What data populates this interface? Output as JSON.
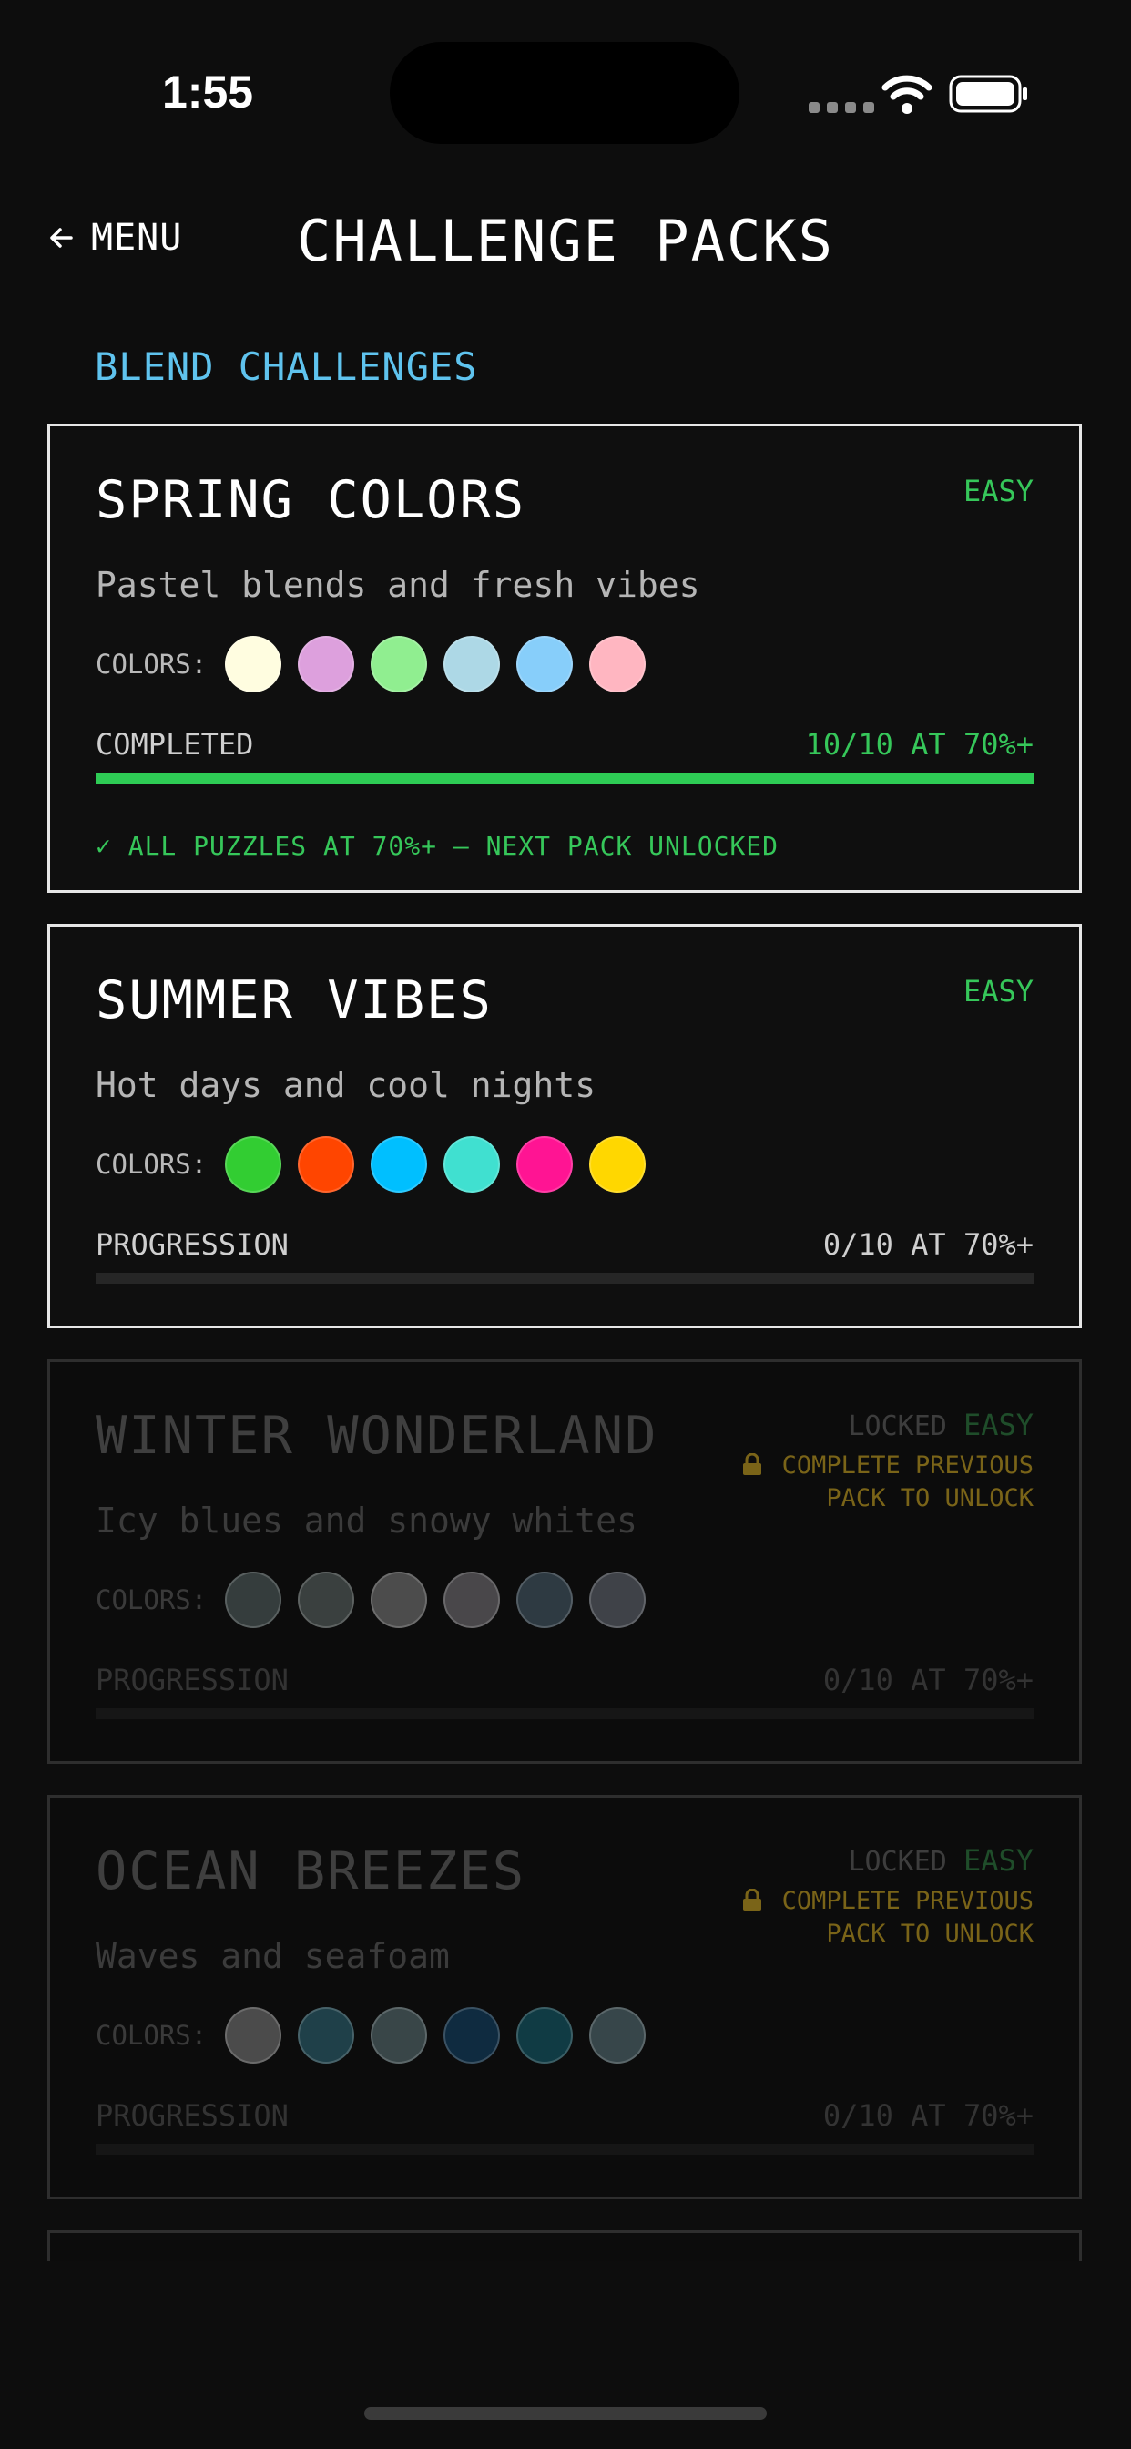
{
  "status_bar": {
    "time": "1:55"
  },
  "header": {
    "back_label": "MENU",
    "title": "CHALLENGE PACKS"
  },
  "section": {
    "title": "BLEND CHALLENGES"
  },
  "packs": [
    {
      "title": "SPRING COLORS",
      "difficulty": "EASY",
      "description": "Pastel blends and fresh vibes",
      "colors_label": "COLORS:",
      "colors": [
        "#fffde0",
        "#dda0dd",
        "#90ee90",
        "#add8e6",
        "#87cefa",
        "#ffb6c1"
      ],
      "progress_label": "COMPLETED",
      "progress_value": "10/10 AT 70%+",
      "progress_fraction": 1.0,
      "completion_note": "✓ ALL PUZZLES AT 70%+ — NEXT PACK UNLOCKED"
    },
    {
      "title": "SUMMER VIBES",
      "difficulty": "EASY",
      "description": "Hot days and cool nights",
      "colors_label": "COLORS:",
      "colors": [
        "#32cd32",
        "#ff4500",
        "#00bfff",
        "#40e0d0",
        "#ff1493",
        "#ffd700"
      ],
      "progress_label": "PROGRESSION",
      "progress_value": "0/10 AT 70%+",
      "progress_fraction": 0.0
    },
    {
      "title": "WINTER WONDERLAND",
      "locked_label": "LOCKED",
      "difficulty": "EASY",
      "unlock_line1": "COMPLETE PREVIOUS",
      "unlock_line2": "PACK TO UNLOCK",
      "description": "Icy blues and snowy whites",
      "colors_label": "COLORS:",
      "colors": [
        "#353d3d",
        "#3a403f",
        "#4c4c4c",
        "#49474a",
        "#2e3a42",
        "#3f4248"
      ],
      "progress_label": "PROGRESSION",
      "progress_value": "0/10 AT 70%+",
      "progress_fraction": 0.0
    },
    {
      "title": "OCEAN BREEZES",
      "locked_label": "LOCKED",
      "difficulty": "EASY",
      "unlock_line1": "COMPLETE PREVIOUS",
      "unlock_line2": "PACK TO UNLOCK",
      "description": "Waves and seafoam",
      "colors_label": "COLORS:",
      "colors": [
        "#4b4b4b",
        "#1f4049",
        "#394648",
        "#0f2b40",
        "#103b44",
        "#37464a"
      ],
      "progress_label": "PROGRESSION",
      "progress_value": "0/10 AT 70%+",
      "progress_fraction": 0.0
    }
  ],
  "icons": {
    "back": "arrow-left-icon",
    "lock": "lock-icon",
    "wifi": "wifi-icon",
    "battery": "battery-icon"
  },
  "accent_colors": {
    "section": "#5fc3ee",
    "success": "#2ecc55",
    "lock_note": "#7a6418"
  }
}
